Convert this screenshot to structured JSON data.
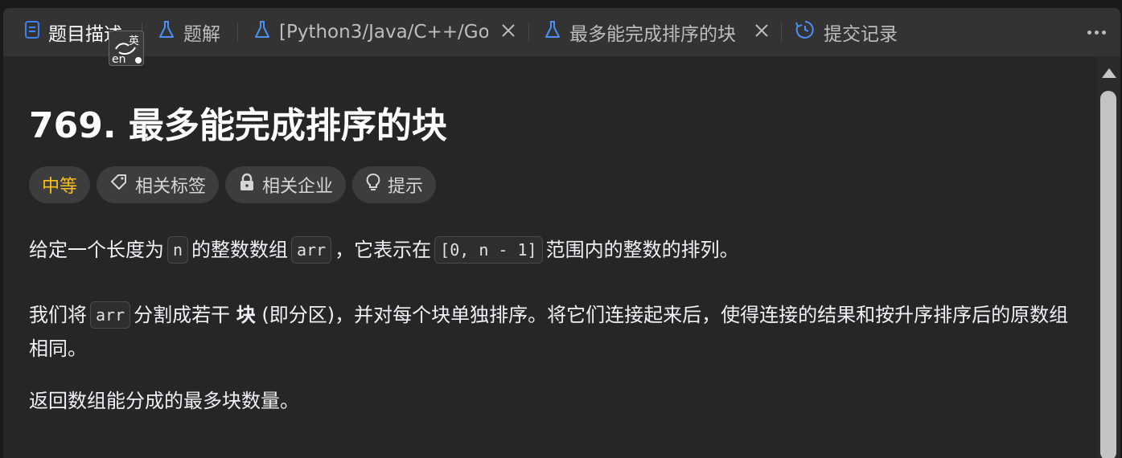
{
  "tabs": [
    {
      "label": "题目描述",
      "icon": "document-icon",
      "active": true
    },
    {
      "label": "题解",
      "icon": "flask-icon",
      "active": false
    },
    {
      "label": "[Python3/Java/C++/Go]",
      "icon": "flask-icon",
      "active": false
    },
    {
      "label": "最多能完成排序的块",
      "icon": "flask-icon",
      "active": false
    },
    {
      "label": "提交记录",
      "icon": "history-icon",
      "active": false
    }
  ],
  "ime_badge": {
    "top_char": "英",
    "bottom_text": "en"
  },
  "problem": {
    "number": "769.",
    "name": "最多能完成排序的块"
  },
  "pills": {
    "difficulty": "中等",
    "tags": "相关标签",
    "companies": "相关企业",
    "hint": "提示"
  },
  "description": {
    "p1_a": "给定一个长度为",
    "p1_code1": "n",
    "p1_b": "的整数数组",
    "p1_code2": "arr",
    "p1_c": "，它表示在",
    "p1_code3": "[0, n - 1]",
    "p1_d": "范围内的整数的排列。",
    "p2_a": "我们将",
    "p2_code1": "arr",
    "p2_b": "分割成若干",
    "p2_bold": "块",
    "p2_c": "(即分区)，并对每个块单独排序。将它们连接起来后，使得连接的结果和按升序排序后的原数组相同。",
    "p3": "返回数组能分成的最多块数量。"
  },
  "colors": {
    "difficulty_medium": "#ffc01e",
    "tab_active_icon": "#3b82f6",
    "panel_bg": "#262626"
  }
}
